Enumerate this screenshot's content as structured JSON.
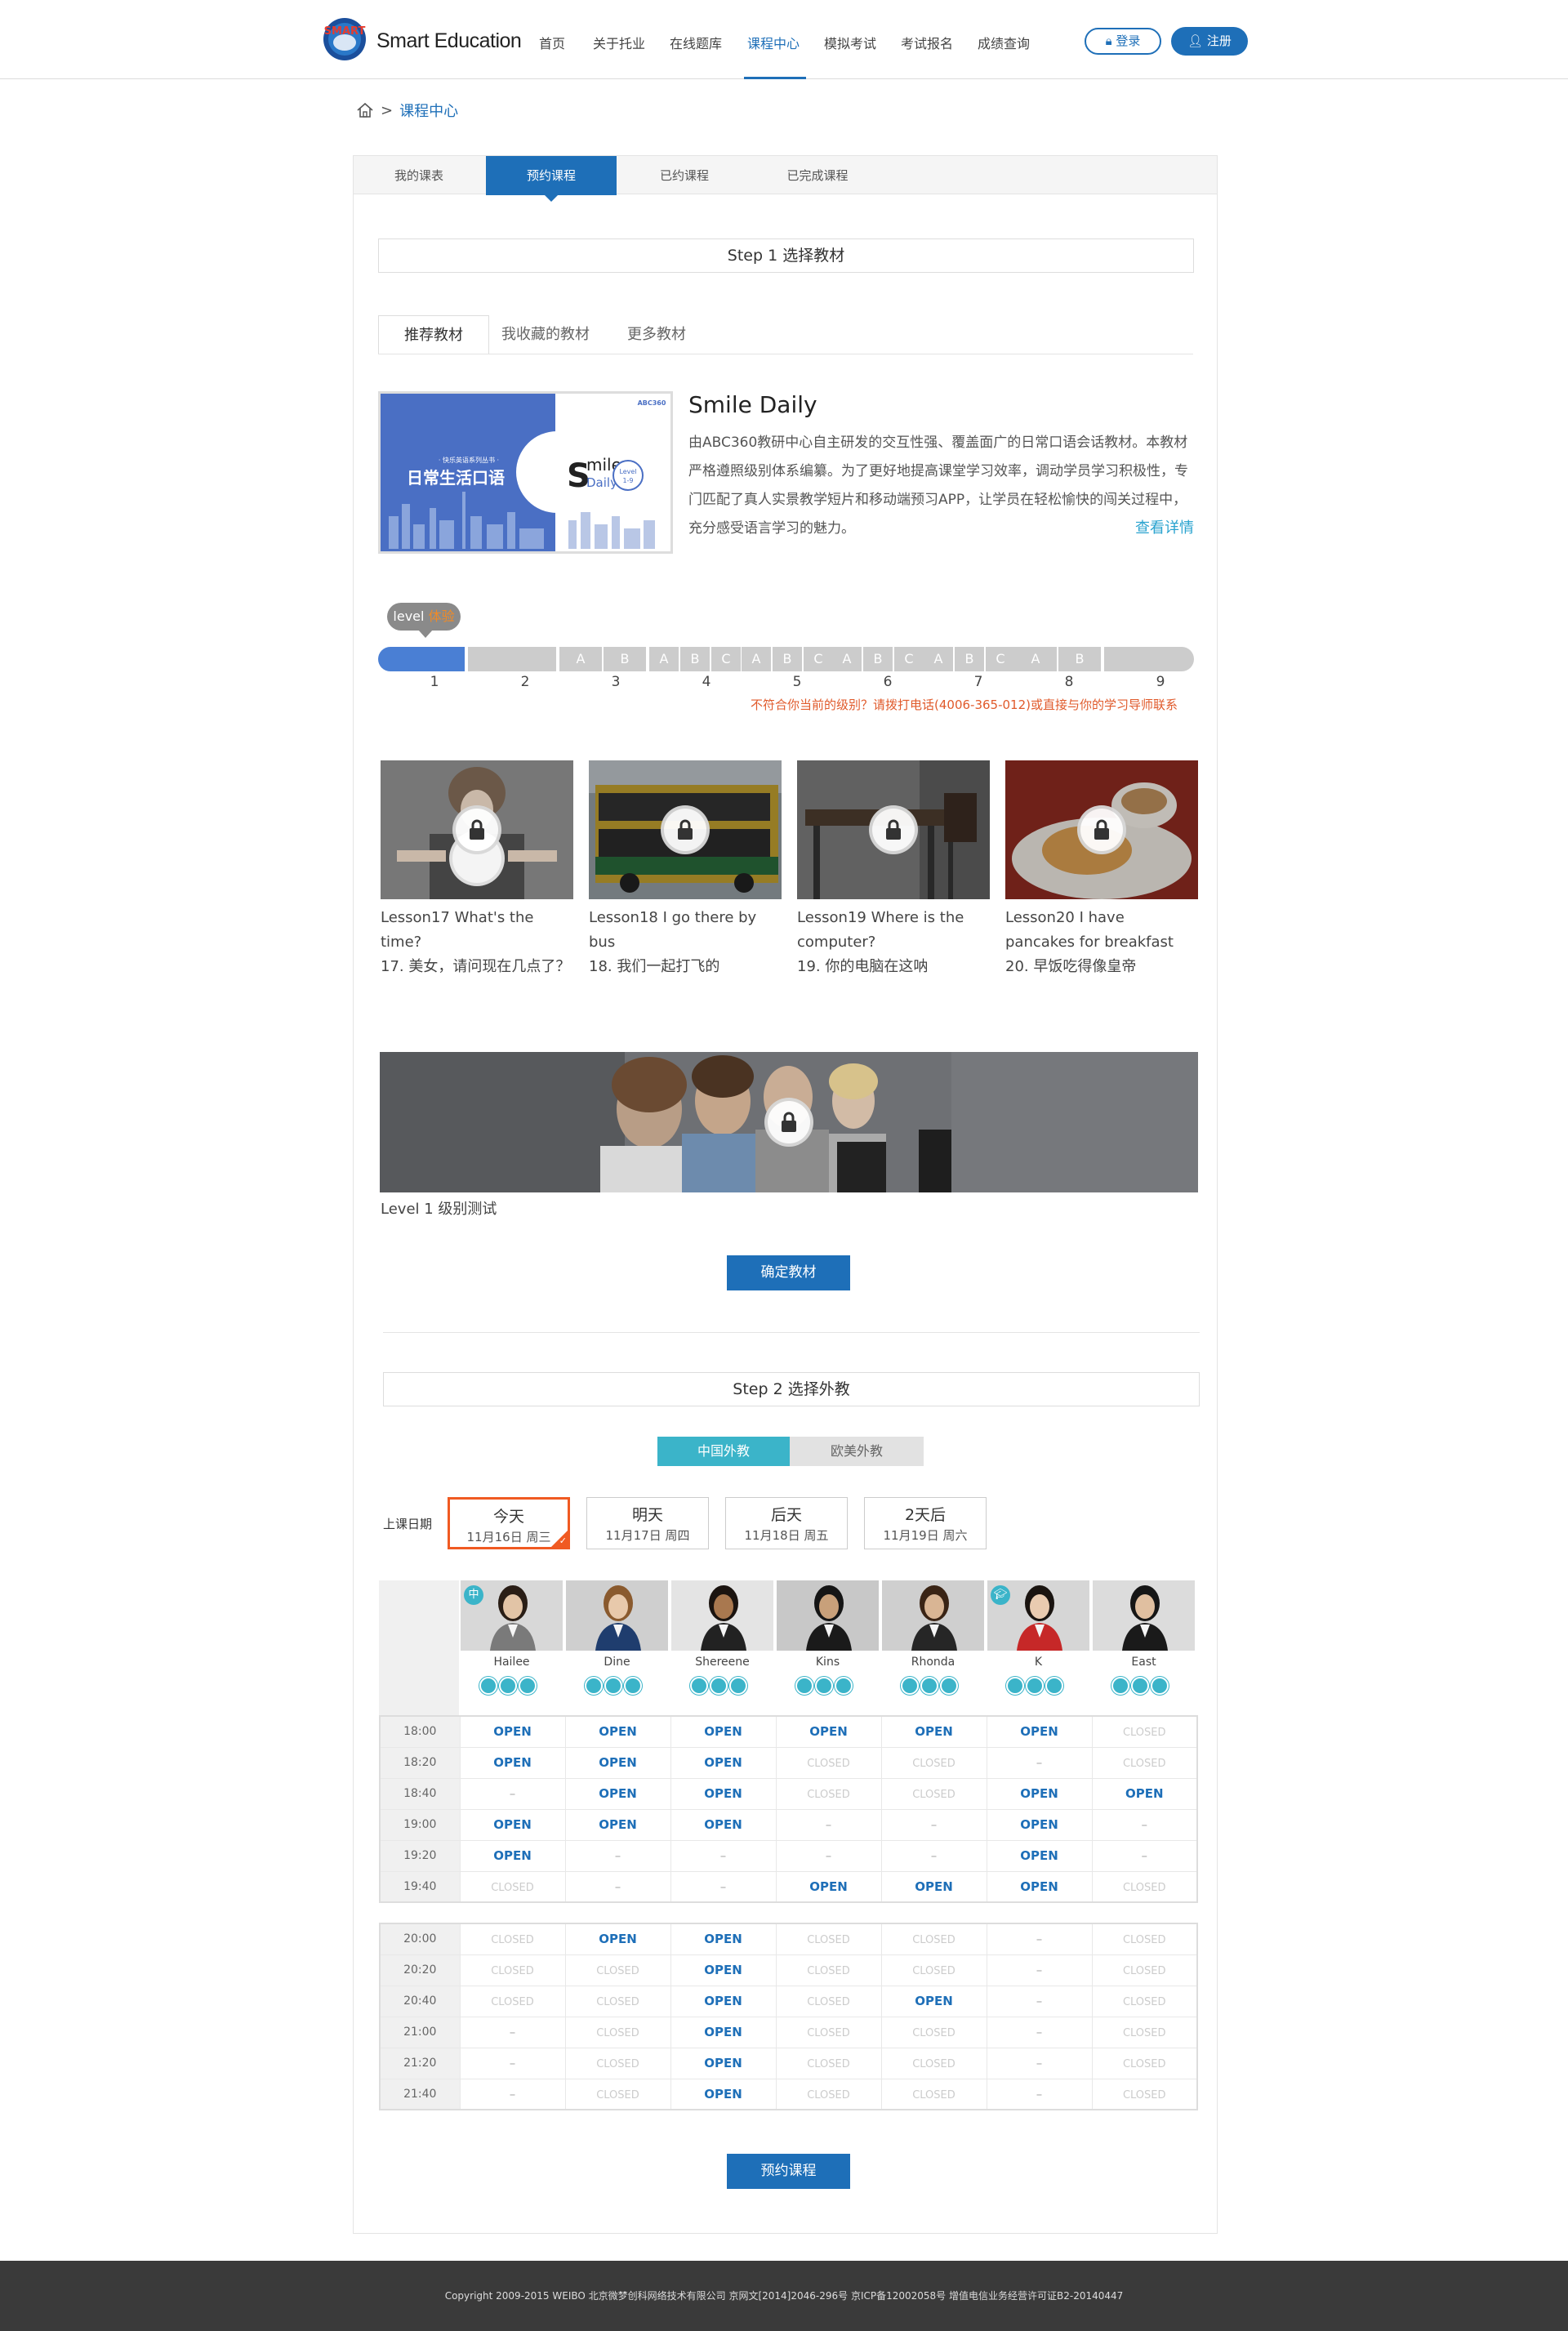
{
  "header": {
    "brand": "Smart Education",
    "logo_text": "SMART",
    "nav": [
      "首页",
      "关于托业",
      "在线题库",
      "课程中心",
      "模拟考试",
      "考试报名",
      "成绩查询"
    ],
    "active_nav_index": 3,
    "login_label": "登录",
    "register_label": "注册"
  },
  "breadcrumb": {
    "sep": ">",
    "current": "课程中心"
  },
  "tabs": [
    "我的课表",
    "预约课程",
    "已约课程",
    "已完成课程"
  ],
  "active_tab_index": 1,
  "step1": {
    "title": "Step 1  选择教材",
    "subtabs": [
      "推荐教材",
      "我收藏的教材",
      "更多教材"
    ],
    "book": {
      "title": "Smile Daily",
      "description": "由ABC360教研中心自主研发的交互性强、覆盖面广的日常口语会话教材。本教材严格遵照级别体系编纂。为了更好地提高课堂学习效率，调动学员学习积极性，专门匹配了真人实景教学短片和移动端预习APP，让学员在轻松愉快的闯关过程中，充分感受语言学习的魅力。",
      "more_label": "查看详情",
      "cover": {
        "series": "· 快乐英语系列丛书 ·",
        "cn_title": "日常生活口语",
        "logo": "ABC360",
        "word1": "mile",
        "word2": "Daily",
        "s": "S",
        "level": "Level",
        "level_range": "1-9"
      }
    },
    "level": {
      "badge_prefix": "level",
      "badge_highlight": "体验",
      "sublabels": [
        "A",
        "B",
        "A",
        "B",
        "C",
        "A",
        "B",
        "C",
        "A",
        "B",
        "C",
        "A",
        "B",
        "C",
        "A",
        "B"
      ],
      "numbers": [
        "1",
        "2",
        "3",
        "4",
        "5",
        "6",
        "7",
        "8",
        "9"
      ],
      "warning": "不符合你当前的级别？请拨打电话(4006-365-012)或直接与你的学习导师联系"
    },
    "lessons": [
      {
        "title": "Lesson17 What's the time?",
        "cn": "17. 美女，请问现在几点了？"
      },
      {
        "title": "Lesson18 I go there by bus",
        "cn": "18. 我们一起打飞的"
      },
      {
        "title": "Lesson19 Where is the computer?",
        "cn": "19. 你的电脑在这呐"
      },
      {
        "title": "Lesson20 I have pancakes for breakfast",
        "cn": "20. 早饭吃得像皇帝"
      }
    ],
    "level_test_label": "Level 1 级别测试",
    "confirm_label": "确定教材"
  },
  "step2": {
    "title": "Step 2  选择外教",
    "teacher_types": [
      "中国外教",
      "欧美外教"
    ],
    "date_label": "上课日期",
    "dates": [
      {
        "main": "今天",
        "sub": "11月16日 周三"
      },
      {
        "main": "明天",
        "sub": "11月17日 周四"
      },
      {
        "main": "后天",
        "sub": "11月18日 周五"
      },
      {
        "main": "2天后",
        "sub": "11月19日 周六"
      }
    ],
    "teachers": [
      "Hailee",
      "Dine",
      "Shereene",
      "Kins",
      "Rhonda",
      "K",
      "East"
    ],
    "badge_zh": "中",
    "schedule_morning": [
      {
        "time": "18:00",
        "slots": [
          "OPEN",
          "OPEN",
          "OPEN",
          "OPEN",
          "OPEN",
          "OPEN",
          "CLOSED"
        ]
      },
      {
        "time": "18:20",
        "slots": [
          "OPEN",
          "OPEN",
          "OPEN",
          "CLOSED",
          "CLOSED",
          "–",
          "CLOSED"
        ]
      },
      {
        "time": "18:40",
        "slots": [
          "–",
          "OPEN",
          "OPEN",
          "CLOSED",
          "CLOSED",
          "OPEN",
          "OPEN"
        ]
      },
      {
        "time": "19:00",
        "slots": [
          "OPEN",
          "OPEN",
          "OPEN",
          "–",
          "–",
          "OPEN",
          "–"
        ]
      },
      {
        "time": "19:20",
        "slots": [
          "OPEN",
          "–",
          "–",
          "–",
          "–",
          "OPEN",
          "–"
        ]
      },
      {
        "time": "19:40",
        "slots": [
          "CLOSED",
          "–",
          "–",
          "OPEN",
          "OPEN",
          "OPEN",
          "CLOSED"
        ]
      }
    ],
    "schedule_evening": [
      {
        "time": "20:00",
        "slots": [
          "CLOSED",
          "OPEN",
          "OPEN",
          "CLOSED",
          "CLOSED",
          "–",
          "CLOSED"
        ]
      },
      {
        "time": "20:20",
        "slots": [
          "CLOSED",
          "CLOSED",
          "OPEN",
          "CLOSED",
          "CLOSED",
          "–",
          "CLOSED"
        ]
      },
      {
        "time": "20:40",
        "slots": [
          "CLOSED",
          "CLOSED",
          "OPEN",
          "CLOSED",
          "OPEN",
          "–",
          "CLOSED"
        ]
      },
      {
        "time": "21:00",
        "slots": [
          "–",
          "CLOSED",
          "OPEN",
          "CLOSED",
          "CLOSED",
          "–",
          "CLOSED"
        ]
      },
      {
        "time": "21:20",
        "slots": [
          "–",
          "CLOSED",
          "OPEN",
          "CLOSED",
          "CLOSED",
          "–",
          "CLOSED"
        ]
      },
      {
        "time": "21:40",
        "slots": [
          "–",
          "CLOSED",
          "OPEN",
          "CLOSED",
          "CLOSED",
          "–",
          "CLOSED"
        ]
      }
    ],
    "book_label": "预约课程"
  },
  "footer": "Copyright  2009-2015 WEIBO 北京微梦创科网络技术有限公司 京网文[2014]2046-296号 京ICP备12002058号 增值电信业务经营许可证B2-20140447",
  "colors": {
    "primary": "#1e6fb8",
    "accent_teal": "#3bb4c9",
    "warning": "#e05a2b",
    "active_date": "#f05a22"
  }
}
